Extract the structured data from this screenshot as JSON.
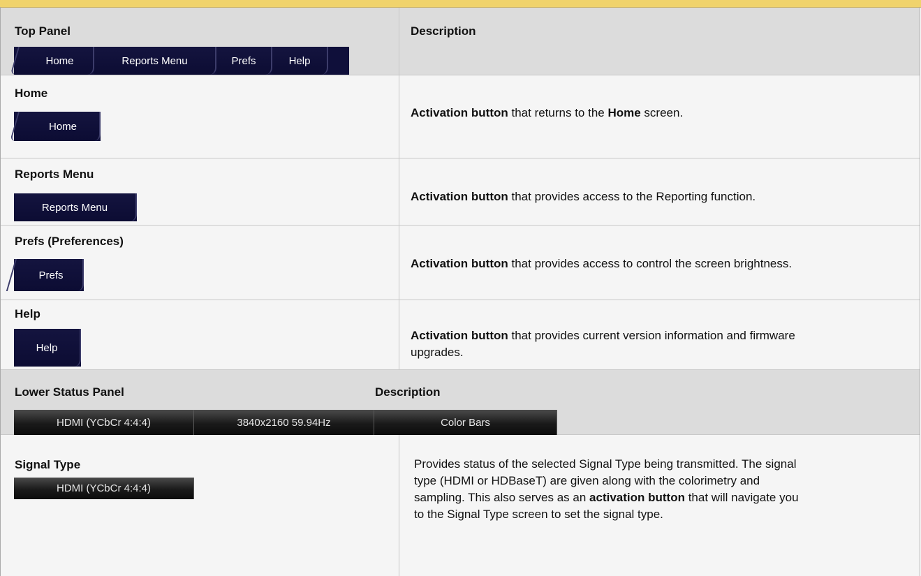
{
  "header": {
    "left_title": "Top Panel",
    "right_title": "Description"
  },
  "top_panel": {
    "tabs": [
      {
        "label": "Home"
      },
      {
        "label": "Reports Menu"
      },
      {
        "label": "Prefs"
      },
      {
        "label": "Help"
      }
    ]
  },
  "rows": [
    {
      "title": "Home",
      "button_label": "Home",
      "desc_bold": "Activation button",
      "desc_mid": " that returns to the ",
      "desc_bold2": "Home",
      "desc_end": " screen."
    },
    {
      "title": "Reports Menu",
      "button_label": "Reports Menu",
      "desc_bold": "Activation button",
      "desc_end": " that provides access to the Reporting function."
    },
    {
      "title": "Prefs (Preferences)",
      "button_label": "Prefs",
      "desc_bold": "Activation button",
      "desc_end": " that provides access to control the screen brightness."
    },
    {
      "title": "Help",
      "button_label": "Help",
      "desc_bold": "Activation button",
      "desc_line1_end": " that provides current version information and firmware",
      "desc_line2": "upgrades."
    }
  ],
  "lower_header": {
    "left_title": "Lower Status Panel",
    "right_title": "Description",
    "status": [
      {
        "label": "HDMI (YCbCr 4:4:4)"
      },
      {
        "label": "3840x2160 59.94Hz"
      },
      {
        "label": "Color Bars"
      }
    ]
  },
  "signal_row": {
    "title": "Signal Type",
    "button_label": "HDMI (YCbCr 4:4:4)",
    "line1": "Provides status of the selected Signal Type being transmitted. The signal",
    "line2": "type (HDMI or HDBaseT) are given along with the colorimetry and",
    "line3_start": "sampling. This also serves as an ",
    "line3_bold": "activation button",
    "line3_end": " that will navigate you",
    "line4": "to the Signal Type screen to set the signal type."
  }
}
